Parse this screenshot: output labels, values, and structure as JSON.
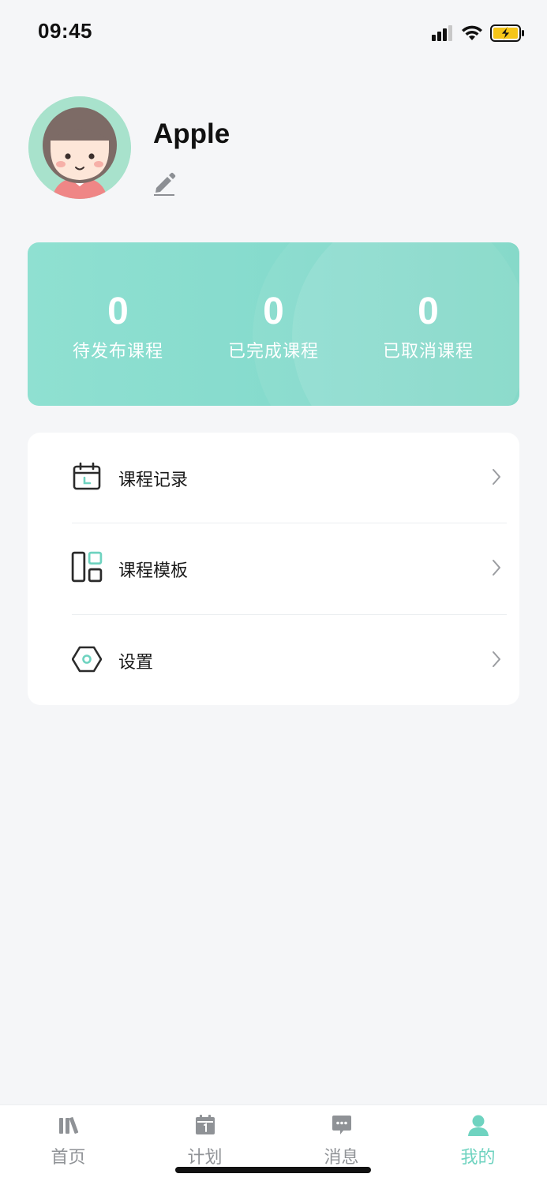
{
  "status_bar": {
    "time": "09:45",
    "icons": [
      "signal-icon",
      "wifi-icon",
      "battery-charging-icon"
    ]
  },
  "profile": {
    "name": "Apple",
    "avatar_icon": "avatar-girl",
    "edit_icon": "pencil-icon"
  },
  "stats": [
    {
      "value": "0",
      "label": "待发布课程"
    },
    {
      "value": "0",
      "label": "已完成课程"
    },
    {
      "value": "0",
      "label": "已取消课程"
    }
  ],
  "menu": [
    {
      "label": "课程记录",
      "icon": "calendar-icon"
    },
    {
      "label": "课程模板",
      "icon": "template-icon"
    },
    {
      "label": "设置",
      "icon": "settings-icon"
    }
  ],
  "tabs": [
    {
      "label": "首页",
      "icon": "books-icon",
      "active": false
    },
    {
      "label": "计划",
      "icon": "calendar-day-icon",
      "active": false
    },
    {
      "label": "消息",
      "icon": "message-icon",
      "active": false
    },
    {
      "label": "我的",
      "icon": "person-icon",
      "active": true
    }
  ],
  "colors": {
    "accent": "#6fd3c0",
    "stats_card": "#86dbcd",
    "background": "#f5f6f8",
    "tab_inactive": "#8f9296"
  }
}
